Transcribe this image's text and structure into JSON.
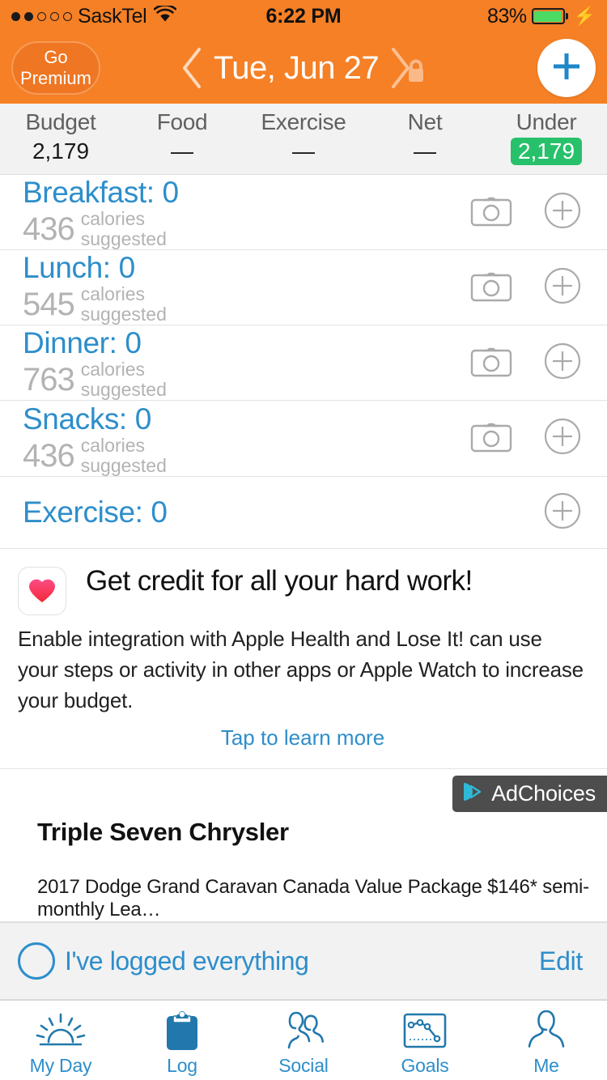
{
  "status_bar": {
    "signal_dots_filled": 2,
    "signal_dots_total": 5,
    "carrier": "SaskTel",
    "wifi_icon": "wifi-icon",
    "time": "6:22 PM",
    "battery_percent": "83%",
    "battery_level": 83,
    "charging_icon": "lightning-bolt-icon"
  },
  "nav": {
    "go_premium_line1": "Go",
    "go_premium_line2": "Premium",
    "prev_icon": "chevron-left-icon",
    "date": "Tue, Jun 27",
    "next_icon": "chevron-right-icon",
    "lock_icon": "lock-icon",
    "add_icon": "plus-icon"
  },
  "summary": {
    "columns": [
      {
        "label": "Budget",
        "value": "2,179",
        "style": "plain"
      },
      {
        "label": "Food",
        "value": "—",
        "style": "plain"
      },
      {
        "label": "Exercise",
        "value": "—",
        "style": "plain"
      },
      {
        "label": "Net",
        "value": "—",
        "style": "plain"
      },
      {
        "label": "Under",
        "value": "2,179",
        "style": "badge"
      }
    ],
    "badge_color": "#27c16b"
  },
  "meals": [
    {
      "title": "Breakfast: 0",
      "calories": "436",
      "suggested_line1": "calories",
      "suggested_line2": "suggested",
      "camera_icon": "camera-icon",
      "add_icon": "plus-circle-icon"
    },
    {
      "title": "Lunch: 0",
      "calories": "545",
      "suggested_line1": "calories",
      "suggested_line2": "suggested",
      "camera_icon": "camera-icon",
      "add_icon": "plus-circle-icon"
    },
    {
      "title": "Dinner: 0",
      "calories": "763",
      "suggested_line1": "calories",
      "suggested_line2": "suggested",
      "camera_icon": "camera-icon",
      "add_icon": "plus-circle-icon"
    },
    {
      "title": "Snacks: 0",
      "calories": "436",
      "suggested_line1": "calories",
      "suggested_line2": "suggested",
      "camera_icon": "camera-icon",
      "add_icon": "plus-circle-icon"
    }
  ],
  "exercise": {
    "title": "Exercise: 0",
    "add_icon": "plus-circle-icon"
  },
  "health_card": {
    "icon": "apple-health-heart-icon",
    "headline": "Get credit for all your hard work!",
    "body": "Enable integration with Apple Health and Lose It! can use your steps or activity in other apps or Apple Watch to increase your budget.",
    "link": "Tap to learn more"
  },
  "ad": {
    "adchoices_label": "AdChoices",
    "adchoices_icon": "adchoices-icon",
    "title": "Triple Seven Chrysler",
    "description": "2017 Dodge Grand Caravan Canada Value Package   $146* semi-monthly Lea…"
  },
  "logged_bar": {
    "checkbox_icon": "empty-circle-checkbox",
    "label": "I've logged everything",
    "edit_label": "Edit"
  },
  "tabbar": {
    "items": [
      {
        "label": "My Day",
        "icon": "sunrise-icon",
        "selected": false
      },
      {
        "label": "Log",
        "icon": "clipboard-icon",
        "selected": true
      },
      {
        "label": "Social",
        "icon": "two-people-icon",
        "selected": false
      },
      {
        "label": "Goals",
        "icon": "chart-box-icon",
        "selected": false
      },
      {
        "label": "Me",
        "icon": "person-icon",
        "selected": false
      }
    ],
    "accent_color": "#2278ad"
  },
  "colors": {
    "header_orange": "#f58026",
    "link_blue": "#2d8ecb",
    "tab_blue": "#2278ad",
    "under_green": "#27c16b",
    "muted_gray": "#b3b3b3"
  }
}
